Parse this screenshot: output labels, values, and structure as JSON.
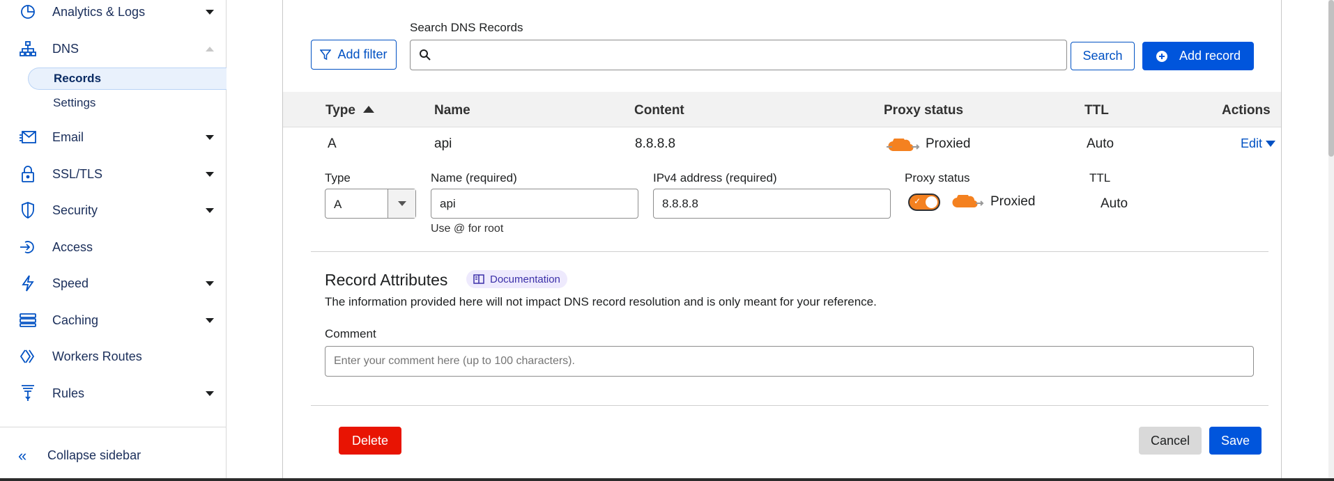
{
  "sidebar": {
    "items": [
      {
        "label": "Analytics & Logs",
        "icon": "pie-chart-icon",
        "caret": "down"
      },
      {
        "label": "DNS",
        "icon": "network-icon",
        "caret": "up"
      },
      {
        "label": "Email",
        "icon": "envelope-icon",
        "caret": "down"
      },
      {
        "label": "SSL/TLS",
        "icon": "lock-icon",
        "caret": "down"
      },
      {
        "label": "Security",
        "icon": "shield-icon",
        "caret": "down"
      },
      {
        "label": "Access",
        "icon": "access-icon",
        "caret": "none"
      },
      {
        "label": "Speed",
        "icon": "lightning-icon",
        "caret": "down"
      },
      {
        "label": "Caching",
        "icon": "stack-icon",
        "caret": "down"
      },
      {
        "label": "Workers Routes",
        "icon": "workers-icon",
        "caret": "none"
      },
      {
        "label": "Rules",
        "icon": "funnel-icon",
        "caret": "down"
      }
    ],
    "dns_sub": [
      {
        "label": "Records",
        "active": true
      },
      {
        "label": "Settings",
        "active": false
      }
    ],
    "collapse_label": "Collapse sidebar"
  },
  "toolbar": {
    "add_filter": "Add filter",
    "search_label": "Search DNS Records",
    "search_placeholder": "",
    "search_button": "Search",
    "add_record": "Add record"
  },
  "table": {
    "headers": {
      "type": "Type",
      "name": "Name",
      "content": "Content",
      "proxy": "Proxy status",
      "ttl": "TTL",
      "actions": "Actions"
    },
    "row": {
      "type": "A",
      "name": "api",
      "content": "8.8.8.8",
      "proxy": "Proxied",
      "ttl": "Auto",
      "edit": "Edit"
    }
  },
  "edit_form": {
    "type_label": "Type",
    "type_value": "A",
    "name_label": "Name (required)",
    "name_value": "api",
    "name_hint": "Use @ for root",
    "ipv4_label": "IPv4 address (required)",
    "ipv4_value": "8.8.8.8",
    "proxy_label": "Proxy status",
    "proxy_value": "Proxied",
    "proxy_enabled": true,
    "ttl_label": "TTL",
    "ttl_value": "Auto",
    "attributes_title": "Record Attributes",
    "documentation_label": "Documentation",
    "attributes_description": "The information provided here will not impact DNS record resolution and is only meant for your reference.",
    "comment_label": "Comment",
    "comment_placeholder": "Enter your comment here (up to 100 characters).",
    "delete_button": "Delete",
    "cancel_button": "Cancel",
    "save_button": "Save"
  },
  "colors": {
    "primary": "#0055dc",
    "danger": "#e81403",
    "proxy_orange": "#f48120",
    "link": "#0051c3"
  }
}
